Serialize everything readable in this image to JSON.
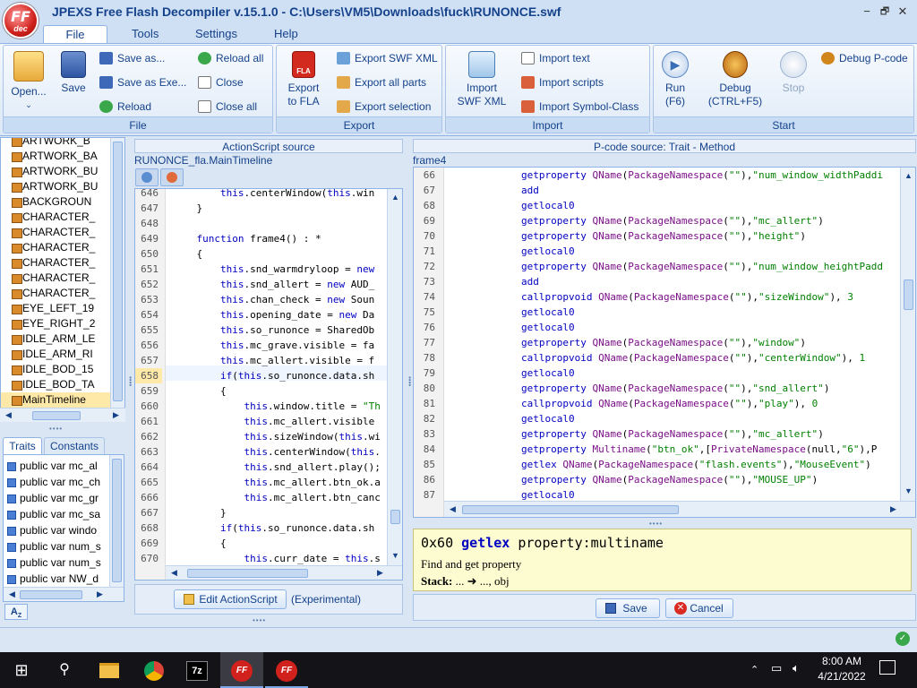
{
  "window": {
    "title": "JPEXS Free Flash Decompiler v.15.1.0 - C:\\Users\\VM5\\Downloads\\fuck\\RUNONCE.swf",
    "logo_top": "FF",
    "logo_bottom": "dec",
    "minimize": "−",
    "restore": "🗗",
    "close": "✕"
  },
  "menu": [
    "File",
    "Tools",
    "Settings",
    "Help"
  ],
  "ribbon": {
    "open": "Open...",
    "save": "Save",
    "save_as": "Save as...",
    "save_as_exe": "Save as Exe...",
    "reload": "Reload",
    "reload_all": "Reload all",
    "close": "Close",
    "close_all": "Close all",
    "file_group": "File",
    "export_to_fla": "Export to FLA",
    "export_fla_line1": "Export",
    "export_fla_line2": "to FLA",
    "fla_badge": "FLA",
    "export_swf_xml": "Export SWF XML",
    "export_all_parts": "Export all parts",
    "export_selection": "Export selection",
    "export_group": "Export",
    "import_swf_xml_line1": "Import",
    "import_swf_xml_line2": "SWF XML",
    "import_text": "Import text",
    "import_scripts": "Import scripts",
    "import_symbol_class": "Import Symbol-Class",
    "import_group": "Import",
    "run_line1": "Run",
    "run_line2": "(F6)",
    "debug_line1": "Debug",
    "debug_line2": "(CTRL+F5)",
    "stop": "Stop",
    "debug_pcode": "Debug P-code",
    "start_group": "Start"
  },
  "tree": [
    "ARTWORK_B",
    "ARTWORK_BA",
    "ARTWORK_BU",
    "ARTWORK_BU",
    "BACKGROUN",
    "CHARACTER_",
    "CHARACTER_",
    "CHARACTER_",
    "CHARACTER_",
    "CHARACTER_",
    "CHARACTER_",
    "EYE_LEFT_19",
    "EYE_RIGHT_2",
    "IDLE_ARM_LE",
    "IDLE_ARM_RI",
    "IDLE_BOD_15",
    "IDLE_BOD_TA",
    "MainTimeline"
  ],
  "traits_tabs": [
    "Traits",
    "Constants"
  ],
  "traits": [
    "public var mc_al",
    "public var mc_ch",
    "public var mc_gr",
    "public var mc_sa",
    "public var windo",
    "public var num_s",
    "public var num_s",
    "public var NW_d"
  ],
  "as_panel": {
    "header": "ActionScript source",
    "class_name": "RUNONCE_fla.MainTimeline",
    "edit_button": "Edit ActionScript",
    "experimental": "(Experimental)",
    "lines": [
      {
        "n": "646",
        "t": "        this.centerWindow(this.win"
      },
      {
        "n": "647",
        "t": "    }"
      },
      {
        "n": "648",
        "t": ""
      },
      {
        "n": "649",
        "t": "    function frame4() : *"
      },
      {
        "n": "650",
        "t": "    {"
      },
      {
        "n": "651",
        "t": "        this.snd_warmdryloop = new"
      },
      {
        "n": "652",
        "t": "        this.snd_allert = new AUD_"
      },
      {
        "n": "653",
        "t": "        this.chan_check = new Soun"
      },
      {
        "n": "654",
        "t": "        this.opening_date = new Da"
      },
      {
        "n": "655",
        "t": "        this.so_runonce = SharedOb"
      },
      {
        "n": "656",
        "t": "        this.mc_grave.visible = fa"
      },
      {
        "n": "657",
        "t": "        this.mc_allert.visible = f"
      },
      {
        "n": "658",
        "t": "        if(this.so_runonce.data.sh"
      },
      {
        "n": "659",
        "t": "        {"
      },
      {
        "n": "660",
        "t": "            this.window.title = \"Th"
      },
      {
        "n": "661",
        "t": "            this.mc_allert.visible "
      },
      {
        "n": "662",
        "t": "            this.sizeWindow(this.wi"
      },
      {
        "n": "663",
        "t": "            this.centerWindow(this."
      },
      {
        "n": "664",
        "t": "            this.snd_allert.play();"
      },
      {
        "n": "665",
        "t": "            this.mc_allert.btn_ok.a"
      },
      {
        "n": "666",
        "t": "            this.mc_allert.btn_canc"
      },
      {
        "n": "667",
        "t": "        }"
      },
      {
        "n": "668",
        "t": "        if(this.so_runonce.data.sh"
      },
      {
        "n": "669",
        "t": "        {"
      },
      {
        "n": "670",
        "t": "            this.curr_date = this.s"
      }
    ]
  },
  "pcode_panel": {
    "header": "P-code source: Trait - Method",
    "frame": "frame4",
    "lines": [
      {
        "n": "66",
        "t": "getproperty QName(PackageNamespace(\"\"),\"num_window_widthPaddi"
      },
      {
        "n": "67",
        "t": "add"
      },
      {
        "n": "68",
        "t": "getlocal0"
      },
      {
        "n": "69",
        "t": "getproperty QName(PackageNamespace(\"\"),\"mc_allert\")"
      },
      {
        "n": "70",
        "t": "getproperty QName(PackageNamespace(\"\"),\"height\")"
      },
      {
        "n": "71",
        "t": "getlocal0"
      },
      {
        "n": "72",
        "t": "getproperty QName(PackageNamespace(\"\"),\"num_window_heightPadd"
      },
      {
        "n": "73",
        "t": "add"
      },
      {
        "n": "74",
        "t": "callpropvoid QName(PackageNamespace(\"\"),\"sizeWindow\"), 3"
      },
      {
        "n": "75",
        "t": "getlocal0"
      },
      {
        "n": "76",
        "t": "getlocal0"
      },
      {
        "n": "77",
        "t": "getproperty QName(PackageNamespace(\"\"),\"window\")"
      },
      {
        "n": "78",
        "t": "callpropvoid QName(PackageNamespace(\"\"),\"centerWindow\"), 1"
      },
      {
        "n": "79",
        "t": "getlocal0"
      },
      {
        "n": "80",
        "t": "getproperty QName(PackageNamespace(\"\"),\"snd_allert\")"
      },
      {
        "n": "81",
        "t": "callpropvoid QName(PackageNamespace(\"\"),\"play\"), 0"
      },
      {
        "n": "82",
        "t": "getlocal0"
      },
      {
        "n": "83",
        "t": "getproperty QName(PackageNamespace(\"\"),\"mc_allert\")"
      },
      {
        "n": "84",
        "t": "getproperty Multiname(\"btn_ok\",[PrivateNamespace(null,\"6\"),P"
      },
      {
        "n": "85",
        "t": "getlex QName(PackageNamespace(\"flash.events\"),\"MouseEvent\")"
      },
      {
        "n": "86",
        "t": "getproperty QName(PackageNamespace(\"\"),\"MOUSE_UP\")"
      },
      {
        "n": "87",
        "t": "getlocal0"
      }
    ]
  },
  "doc": {
    "opcode": "0x60",
    "instruction": "getlex",
    "operand": "property:multiname",
    "description": "Find and get property",
    "stack_label": "Stack:",
    "stack_value": "... ➜ ..., obj"
  },
  "buttons": {
    "save": "Save",
    "cancel": "Cancel"
  },
  "taskbar": {
    "time": "8:00 AM",
    "date": "4/21/2022",
    "icons": [
      "windows-start",
      "search",
      "file-explorer",
      "chrome",
      "7zip",
      "ffdec",
      "ffdec"
    ]
  },
  "colors": {
    "accent": "#15428b",
    "ribbon_bg": "#dbe7f7",
    "selected": "#ffe9a8",
    "doc_bg": "#fdfbd0"
  }
}
